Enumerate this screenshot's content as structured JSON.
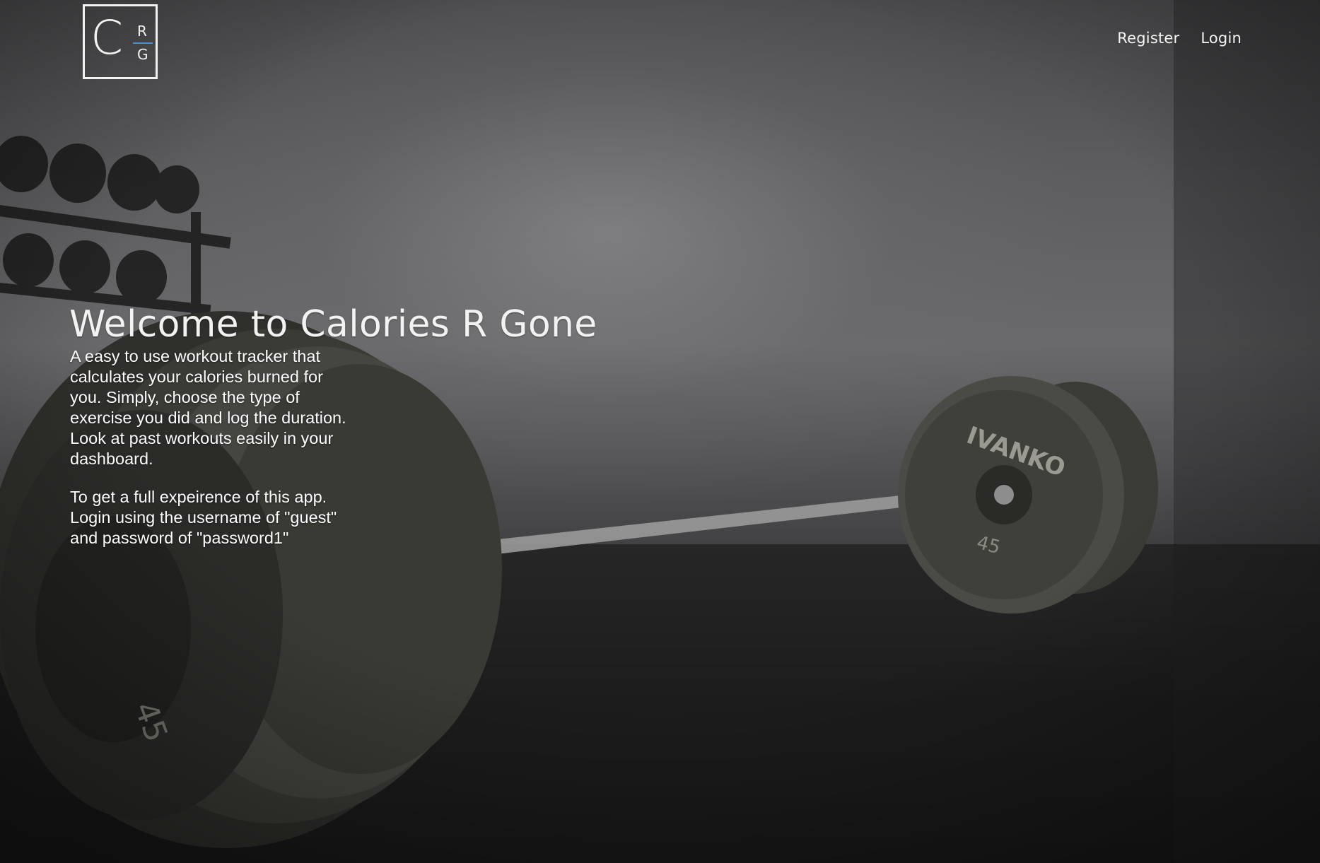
{
  "header": {
    "logo": {
      "letter_main": "C",
      "letter_top": "R",
      "letter_bottom": "G"
    },
    "nav": [
      {
        "label": "Register"
      },
      {
        "label": "Login"
      }
    ]
  },
  "hero": {
    "title": "Welcome to Calories R Gone",
    "description": "A easy to use workout tracker that calculates your calories burned for you. Simply, choose the type of exercise you did and log the duration. Look at past workouts easily in your dashboard.",
    "guest_note": "To get a full expeirence of this app. Login using the username of \"guest\" and password of \"password1\""
  },
  "background": {
    "subject": "gym barbell with weight plates",
    "plate_brand": "IVANKO",
    "plate_weight": "45"
  },
  "colors": {
    "text": "#ffffff",
    "logo_accent": "#4a8fd0"
  }
}
